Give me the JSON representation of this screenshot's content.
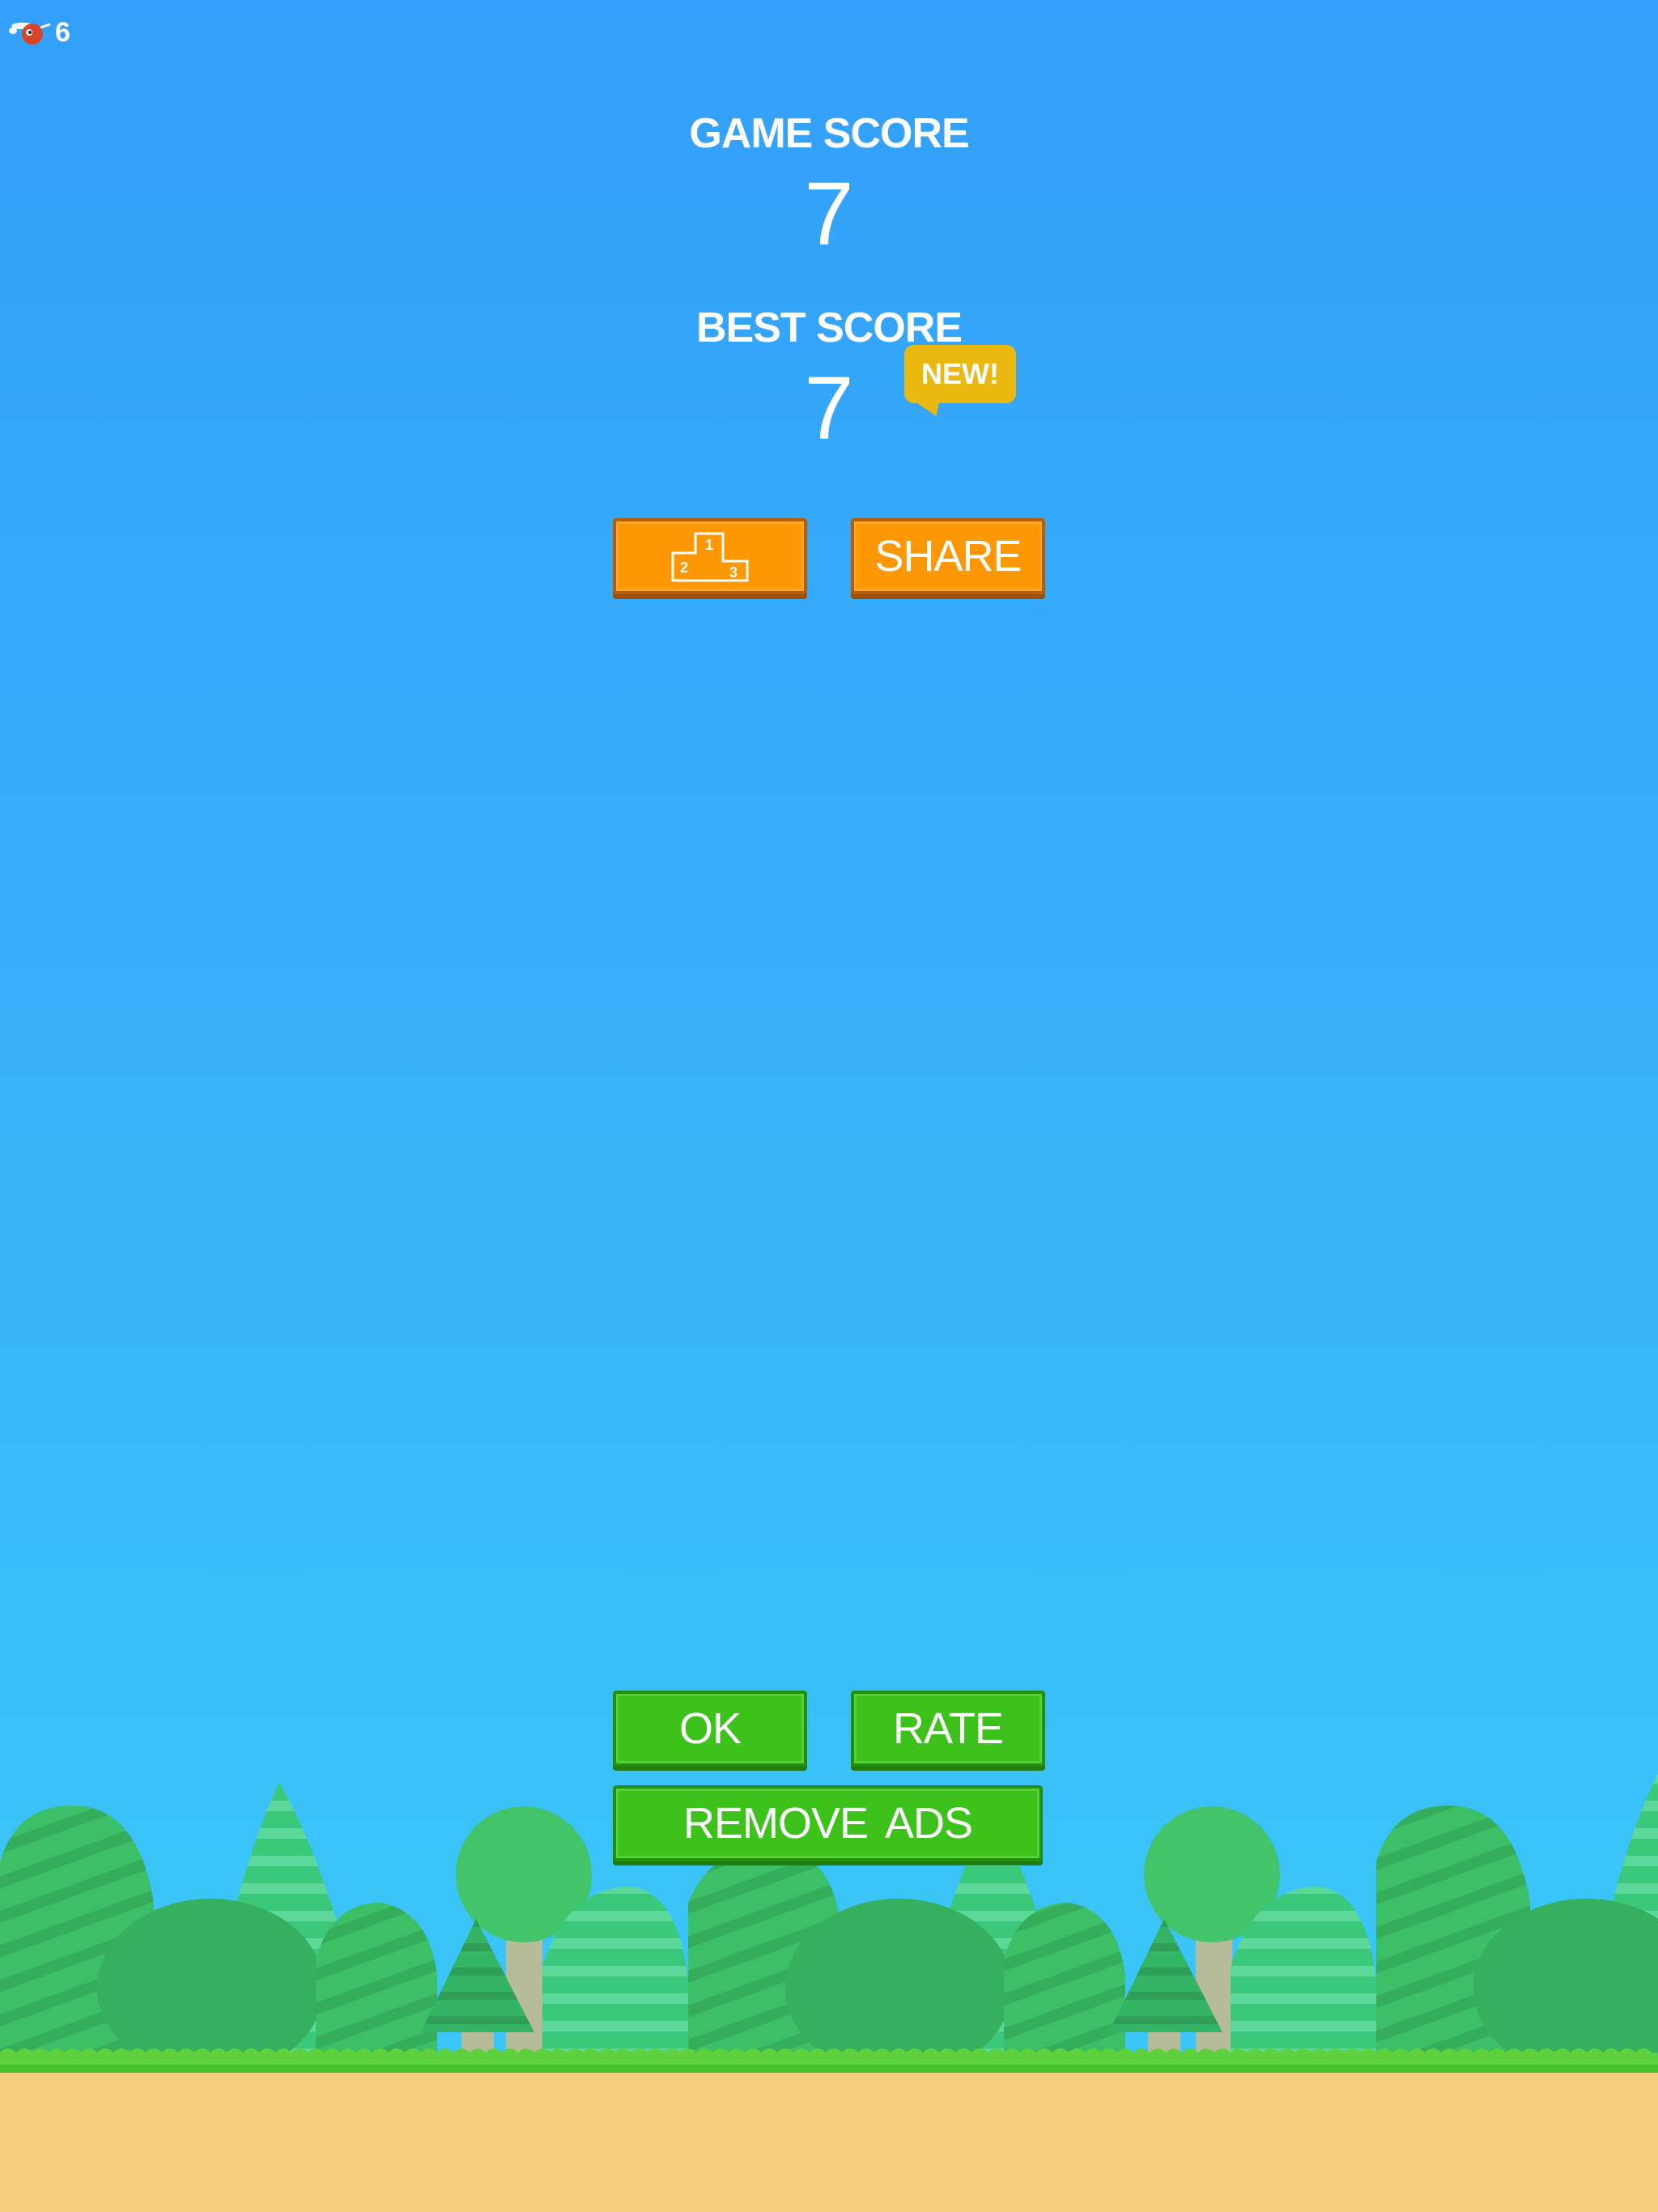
{
  "hud": {
    "coin_count": "6",
    "coin_icon": "flying-ball-icon"
  },
  "scores": {
    "game_label": "GAME SCORE",
    "game_value": "7",
    "best_label": "BEST SCORE",
    "best_value": "7",
    "new_badge": "NEW!"
  },
  "buttons": {
    "leaderboard_icon": "podium-icon",
    "podium_first": "1",
    "podium_second": "2",
    "podium_third": "3",
    "share": "SHARE",
    "ok": "OK",
    "rate": "RATE",
    "remove_ads": "REMOVE  ADS"
  },
  "colors": {
    "sky_top": "#339ffa",
    "sky_bottom": "#3bc8f7",
    "orange_button": "#fd9703",
    "green_button": "#3cc21a",
    "badge": "#e9b811",
    "ground": "#f5cd7a",
    "grass": "#45c12a"
  }
}
